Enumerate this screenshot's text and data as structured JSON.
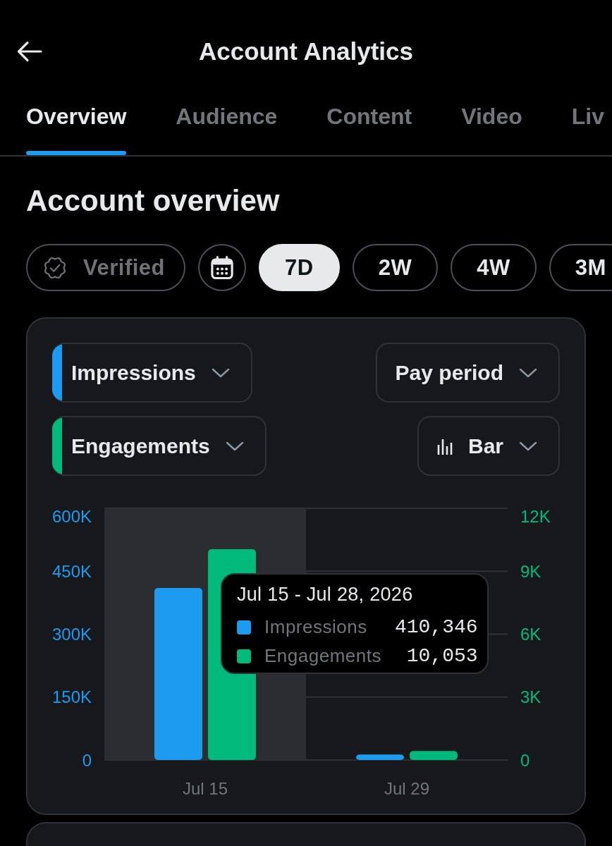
{
  "header": {
    "title": "Account Analytics"
  },
  "tabs": [
    {
      "label": "Overview",
      "selected": true
    },
    {
      "label": "Audience",
      "selected": false
    },
    {
      "label": "Content",
      "selected": false
    },
    {
      "label": "Video",
      "selected": false
    },
    {
      "label": "Liv",
      "selected": false
    }
  ],
  "section": {
    "title": "Account overview"
  },
  "filters": [
    {
      "kind": "badge",
      "label": "Verified",
      "selected": false,
      "disabled": true
    },
    {
      "kind": "calendar",
      "selected": false,
      "disabled": false
    },
    {
      "kind": "range",
      "label": "7D",
      "selected": true,
      "disabled": false
    },
    {
      "kind": "range",
      "label": "2W",
      "selected": false,
      "disabled": false
    },
    {
      "kind": "range",
      "label": "4W",
      "selected": false,
      "disabled": false
    },
    {
      "kind": "range",
      "label": "3M",
      "selected": false,
      "disabled": false
    }
  ],
  "chart_card": {
    "metrics": [
      {
        "label": "Impressions",
        "color": "#1d9bf0"
      },
      {
        "label": "Engagements",
        "color": "#00ba7c"
      }
    ],
    "period": {
      "label": "Pay period"
    },
    "chart_type": {
      "label": "Bar"
    },
    "chart_data": {
      "type": "bar",
      "categories": [
        "Jul 15",
        "Jul 29"
      ],
      "series": [
        {
          "name": "Impressions",
          "color": "#1d9bf0",
          "values": [
            410000,
            13000
          ]
        },
        {
          "name": "Engagements",
          "color": "#00ba7c",
          "axis": "y2",
          "values": [
            10050,
            430
          ]
        }
      ],
      "ylim": [
        0,
        600000
      ],
      "yticks": [
        {
          "value": 0,
          "label": "0"
        },
        {
          "value": 150000,
          "label": "150K"
        },
        {
          "value": 300000,
          "label": "300K"
        },
        {
          "value": 450000,
          "label": "450K"
        },
        {
          "value": 600000,
          "label": "600K"
        }
      ],
      "y2lim": [
        0,
        12000
      ],
      "y2ticks": [
        {
          "value": 0,
          "label": "0"
        },
        {
          "value": 3000,
          "label": "3K"
        },
        {
          "value": 6000,
          "label": "6K"
        },
        {
          "value": 9000,
          "label": "9K"
        },
        {
          "value": 12000,
          "label": "12K"
        }
      ],
      "grid": true,
      "bands": [
        {
          "axis": "x",
          "from": "Jul 15",
          "to": "Jul 15",
          "color": "#2c2d31"
        }
      ]
    },
    "tooltip": {
      "title": "Jul 15 - Jul 28, 2026",
      "values": [
        "410,346",
        "10,053"
      ]
    }
  }
}
